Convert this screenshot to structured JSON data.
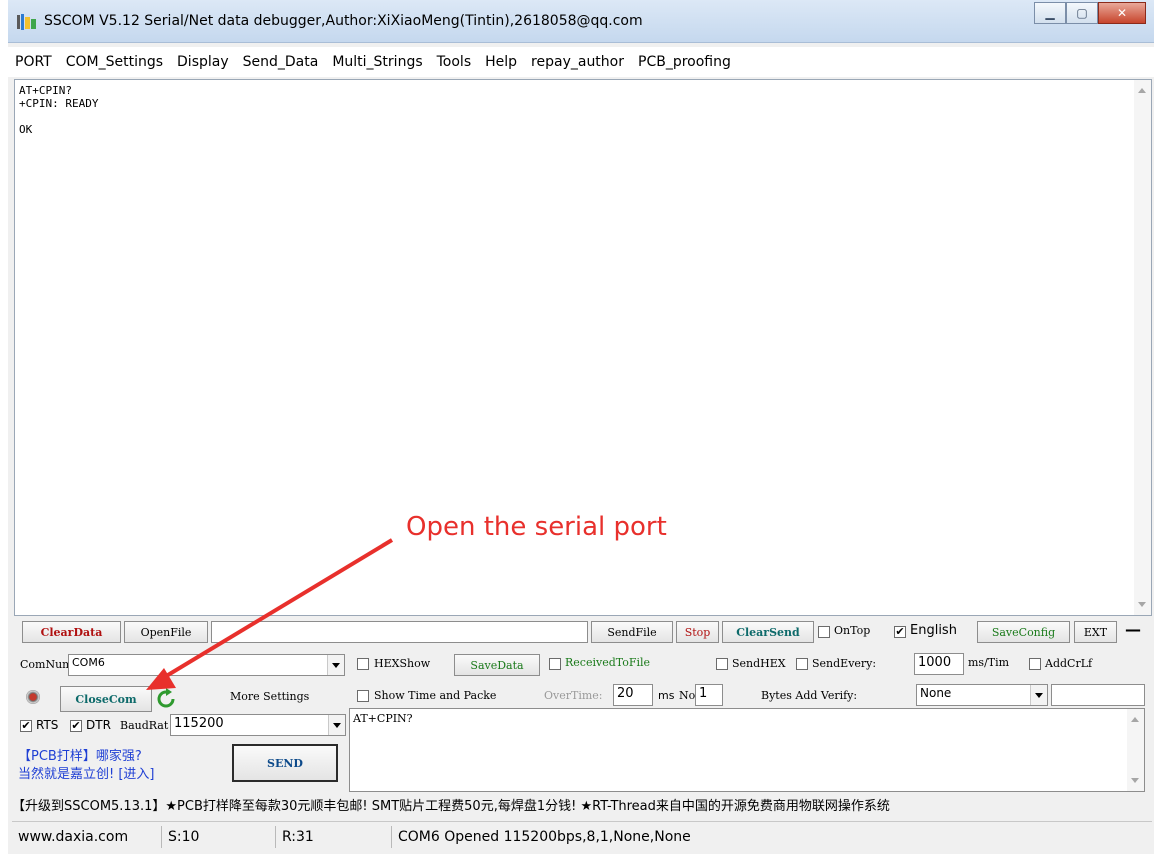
{
  "window": {
    "title": "SSCOM V5.12 Serial/Net data debugger,Author:XiXiaoMeng(Tintin),2618058@qq.com",
    "app_icon": "sscom-icon",
    "caption_buttons": {
      "minimize": "minimize-icon",
      "maximize": "maximize-icon",
      "close": "close-icon"
    }
  },
  "menu": [
    "PORT",
    "COM_Settings",
    "Display",
    "Send_Data",
    "Multi_Strings",
    "Tools",
    "Help",
    "repay_author",
    "PCB_proofing"
  ],
  "receive": {
    "lines": [
      "AT+CPIN?",
      "+CPIN: READY",
      "",
      "OK"
    ]
  },
  "toolbar": {
    "clear_data": "ClearData",
    "open_file": "OpenFile",
    "file_path": "",
    "send_file": "SendFile",
    "stop": "Stop",
    "clear_send": "ClearSend",
    "on_top": {
      "label": "OnTop",
      "checked": false
    },
    "english": {
      "label": "English",
      "checked": true
    },
    "save_config": "SaveConfig",
    "ext": "EXT",
    "collapse": "—"
  },
  "port": {
    "com_num_label": "ComNum",
    "com_num_value": "COM6",
    "close_com": "CloseCom",
    "more_settings": "More Settings",
    "rts": {
      "label": "RTS",
      "checked": true
    },
    "dtr": {
      "label": "DTR",
      "checked": true
    },
    "baud_label": "BaudRat",
    "baud_value": "115200",
    "status_icon": "record-icon",
    "refresh_icon": "refresh-icon"
  },
  "options": {
    "hexshow": {
      "label": "HEXShow",
      "checked": false
    },
    "save_data": "SaveData",
    "received_to_file": {
      "label": "ReceivedToFile",
      "checked": false
    },
    "send_hex": {
      "label": "SendHEX",
      "checked": false
    },
    "send_every": {
      "label": "SendEvery:",
      "checked": false
    },
    "send_every_value": "1000",
    "ms_tim": "ms/Tim",
    "add_crlf": {
      "label": "AddCrLf",
      "checked": false
    },
    "show_time": {
      "label": "Show Time and Packe",
      "checked": false
    },
    "overtime_label": "OverTime:",
    "overtime_value": "20",
    "ms": "ms",
    "no_label": "No",
    "no_value": "1",
    "bytes_add_verify": "Bytes Add Verify:",
    "verify_value": "None"
  },
  "send": {
    "text": "AT+CPIN?",
    "button": "SEND"
  },
  "promo": {
    "line1": "【PCB打样】哪家强?",
    "line2": "当然就是嘉立创! [进入]"
  },
  "ticker": "【升级到SSCOM5.13.1】★PCB打样降至每款30元顺丰包邮! SMT贴片工程费50元,每焊盘1分钱! ★RT-Thread来自中国的开源免费商用物联网操作系统",
  "statusbar": {
    "website": "www.daxia.com",
    "sent": "S:10",
    "received": "R:31",
    "port_status": "COM6 Opened  115200bps,8,1,None,None"
  },
  "annotation": {
    "text": "Open the serial port",
    "color": "#e8302c"
  }
}
